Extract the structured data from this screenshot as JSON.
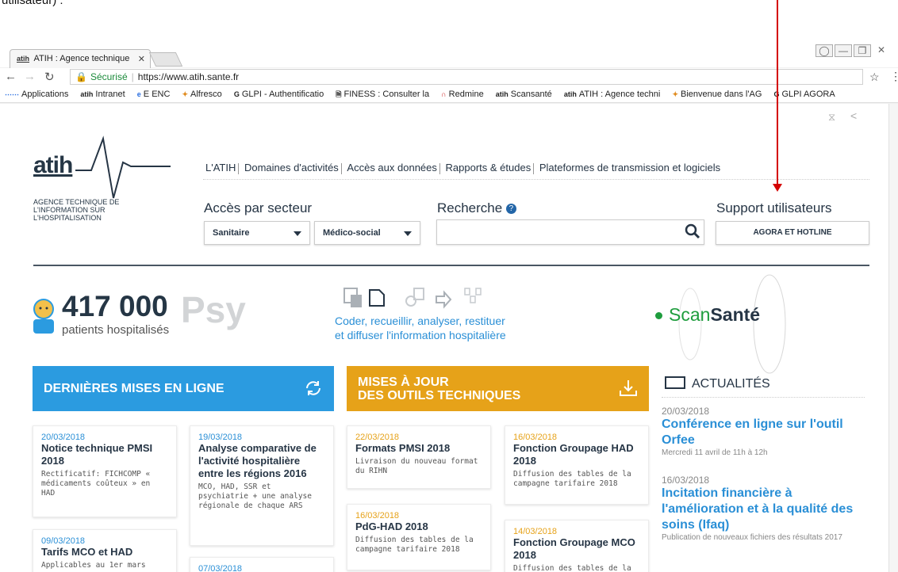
{
  "doc": {
    "caption": "utilisateur) :"
  },
  "browser": {
    "tab_title": "ATIH : Agence technique",
    "tab_icon": "atih",
    "close": "✕",
    "secure_label": "Sécurisé",
    "url": "https://www.atih.sante.fr",
    "bookmarks": [
      {
        "icon": "apps",
        "label": "Applications"
      },
      {
        "icon": "atih",
        "label": "Intranet"
      },
      {
        "icon": "e",
        "label": "E ENC"
      },
      {
        "icon": "alfresco",
        "label": "Alfresco"
      },
      {
        "icon": "G",
        "label": "GLPI - Authentificatio"
      },
      {
        "icon": "doc",
        "label": "FINESS : Consulter la"
      },
      {
        "icon": "redmine",
        "label": "Redmine"
      },
      {
        "icon": "atih",
        "label": "Scansanté"
      },
      {
        "icon": "atih",
        "label": "ATIH : Agence techni"
      },
      {
        "icon": "alfresco",
        "label": "Bienvenue dans l'AG"
      },
      {
        "icon": "G",
        "label": "GLPI AGORA"
      }
    ]
  },
  "header": {
    "logo": "atih",
    "logo_sub": "AGENCE TECHNIQUE DE L'INFORMATION SUR L'HOSPITALISATION",
    "nav": [
      "L'ATIH",
      "Domaines d'activités",
      "Accès aux données",
      "Rapports & études",
      "Plateformes de transmission et logiciels"
    ],
    "sector_title": "Accès par secteur",
    "sector_options": [
      "Sanitaire",
      "Médico-social"
    ],
    "search_title": "Recherche",
    "support_title": "Support utilisateurs",
    "support_button": "AGORA ET HOTLINE"
  },
  "hero": {
    "number": "417 000",
    "number_label": "patients hospitalisés",
    "psy": "Psy",
    "tagline_1": "Coder, recueillir, analyser, restituer",
    "tagline_2": "et diffuser l'information hospitalière",
    "scan_1": "Scan",
    "scan_2": "Santé"
  },
  "sections": {
    "latest_title": "DERNIÈRES MISES EN LIGNE",
    "tools_title_1": "MISES À JOUR",
    "tools_title_2": "DES OUTILS TECHNIQUES",
    "news_title": "ACTUALITÉS"
  },
  "latest_cards": [
    {
      "date": "20/03/2018",
      "title": "Notice technique PMSI 2018",
      "desc": "Rectificatif: FICHCOMP « médicaments coûteux » en HAD"
    },
    {
      "date": "19/03/2018",
      "title": "Analyse comparative de l'activité hospitalière entre les régions 2016",
      "desc": "MCO, HAD, SSR et psychiatrie + une analyse régionale de chaque ARS"
    },
    {
      "date": "09/03/2018",
      "title": "Tarifs MCO et HAD",
      "desc": "Applicables au 1er mars"
    },
    {
      "date": "07/03/2018",
      "title": "",
      "desc": ""
    }
  ],
  "tools_cards": [
    {
      "date": "22/03/2018",
      "title": "Formats PMSI 2018",
      "desc": "Livraison du nouveau format du RIHN"
    },
    {
      "date": "16/03/2018",
      "title": "Fonction Groupage HAD 2018",
      "desc": "Diffusion des tables de la campagne tarifaire 2018"
    },
    {
      "date": "16/03/2018",
      "title": "PdG-HAD 2018",
      "desc": "Diffusion des tables de la campagne tarifaire 2018"
    },
    {
      "date": "14/03/2018",
      "title": "Fonction Groupage MCO 2018",
      "desc": "Diffusion des tables de la"
    }
  ],
  "news": [
    {
      "date": "20/03/2018",
      "title": "Conférence en ligne sur l'outil Orfee",
      "desc": "Mercredi 11 avril de 11h à 12h"
    },
    {
      "date": "16/03/2018",
      "title": "Incitation financière à l'amélioration et à la qualité des soins (Ifaq)",
      "desc": "Publication de nouveaux fichiers des résultats 2017"
    }
  ],
  "colors": {
    "blue": "#2b9be0",
    "orange": "#e6a219",
    "navy": "#263545",
    "green": "#1f9d3e",
    "annotation": "#d40000"
  }
}
